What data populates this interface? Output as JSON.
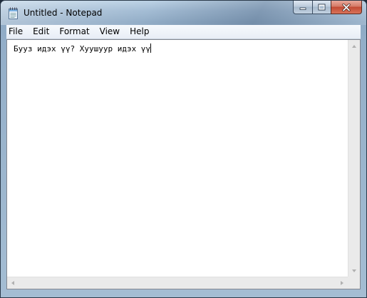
{
  "window": {
    "title": "Untitled - Notepad",
    "app_icon": "notepad-icon"
  },
  "caption_buttons": {
    "minimize_icon": "minimize-icon",
    "maximize_icon": "maximize-icon",
    "close_icon": "close-icon"
  },
  "menu": {
    "items": [
      {
        "label": "File"
      },
      {
        "label": "Edit"
      },
      {
        "label": "Format"
      },
      {
        "label": "View"
      },
      {
        "label": "Help"
      }
    ]
  },
  "editor": {
    "content": "Бууз идэх үү? Хуушуур идэх үү"
  },
  "colors": {
    "close_button": "#c24a33",
    "frame": "#9fb9d2",
    "editor_bg": "#ffffff"
  }
}
